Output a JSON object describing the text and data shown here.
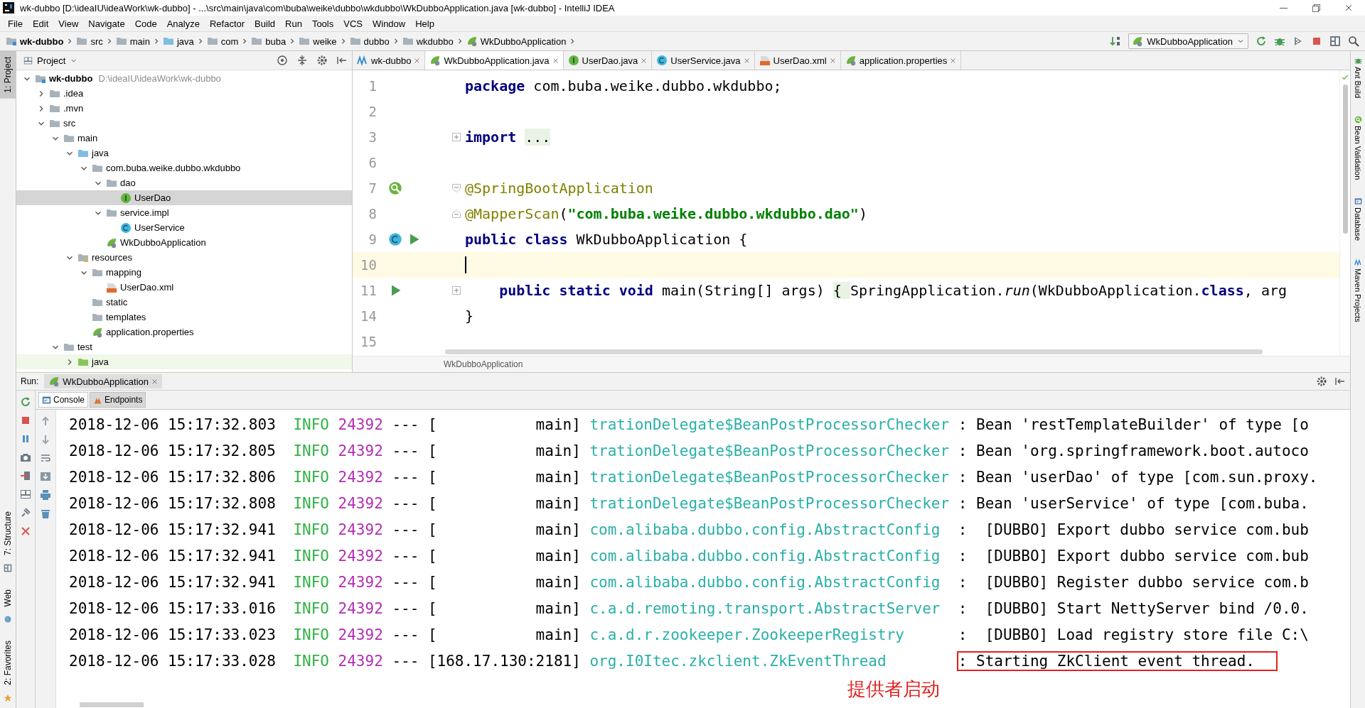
{
  "window": {
    "title": "wk-dubbo [D:\\ideaIU\\ideaWork\\wk-dubbo] - ...\\src\\main\\java\\com\\buba\\weike\\dubbo\\wkdubbo\\WkDubboApplication.java [wk-dubbo] - IntelliJ IDEA"
  },
  "menu": [
    "File",
    "Edit",
    "View",
    "Navigate",
    "Code",
    "Analyze",
    "Refactor",
    "Build",
    "Run",
    "Tools",
    "VCS",
    "Window",
    "Help"
  ],
  "breadcrumbs": [
    {
      "label": "wk-dubbo",
      "kind": "module"
    },
    {
      "label": "src",
      "kind": "folder"
    },
    {
      "label": "main",
      "kind": "folder"
    },
    {
      "label": "java",
      "kind": "source"
    },
    {
      "label": "com",
      "kind": "folder"
    },
    {
      "label": "buba",
      "kind": "folder"
    },
    {
      "label": "weike",
      "kind": "folder"
    },
    {
      "label": "dubbo",
      "kind": "folder"
    },
    {
      "label": "wkdubbo",
      "kind": "folder"
    },
    {
      "label": "WkDubboApplication",
      "kind": "spring"
    }
  ],
  "run_config": {
    "label": "WkDubboApplication"
  },
  "left_strip": [
    {
      "label": "1: Project",
      "selected": true
    },
    {
      "label": "7: Structure",
      "selected": false
    },
    {
      "label": "Web",
      "selected": false
    },
    {
      "label": "2: Favorites",
      "selected": false
    }
  ],
  "right_strip": [
    "Ant Build",
    "Bean Validation",
    "Database",
    "Maven Projects"
  ],
  "project": {
    "title": "Project",
    "tree": [
      {
        "label": "wk-dubbo",
        "kind": "module",
        "path": "D:\\ideaIU\\ideaWork\\wk-dubbo",
        "expanded": true,
        "selected": false,
        "children": [
          {
            "label": ".idea",
            "kind": "folder",
            "expanded": false,
            "selected": false
          },
          {
            "label": ".mvn",
            "kind": "folder",
            "expanded": false,
            "selected": false
          },
          {
            "label": "src",
            "kind": "folder",
            "expanded": true,
            "selected": false,
            "children": [
              {
                "label": "main",
                "kind": "folder",
                "expanded": true,
                "selected": false,
                "children": [
                  {
                    "label": "java",
                    "kind": "source",
                    "expanded": true,
                    "selected": false,
                    "children": [
                      {
                        "label": "com.buba.weike.dubbo.wkdubbo",
                        "kind": "folder",
                        "expanded": true,
                        "selected": false,
                        "children": [
                          {
                            "label": "dao",
                            "kind": "folder",
                            "expanded": true,
                            "selected": false,
                            "children": [
                              {
                                "label": "UserDao",
                                "kind": "interface",
                                "selected": true
                              }
                            ]
                          },
                          {
                            "label": "service.impl",
                            "kind": "folder",
                            "expanded": true,
                            "selected": false,
                            "children": [
                              {
                                "label": "UserService",
                                "kind": "class",
                                "selected": false
                              }
                            ]
                          },
                          {
                            "label": "WkDubboApplication",
                            "kind": "spring",
                            "selected": false
                          }
                        ]
                      }
                    ]
                  },
                  {
                    "label": "resources",
                    "kind": "resources",
                    "expanded": true,
                    "selected": false,
                    "children": [
                      {
                        "label": "mapping",
                        "kind": "folder",
                        "expanded": true,
                        "selected": false,
                        "children": [
                          {
                            "label": "UserDao.xml",
                            "kind": "xml",
                            "selected": false
                          }
                        ]
                      },
                      {
                        "label": "static",
                        "kind": "folder",
                        "selected": false
                      },
                      {
                        "label": "templates",
                        "kind": "folder",
                        "selected": false
                      },
                      {
                        "label": "application.properties",
                        "kind": "properties",
                        "selected": false
                      }
                    ]
                  }
                ]
              },
              {
                "label": "test",
                "kind": "folder",
                "expanded": true,
                "selected": false,
                "children": [
                  {
                    "label": "java",
                    "kind": "test",
                    "expanded": false,
                    "selected": false
                  }
                ]
              }
            ]
          }
        ]
      }
    ]
  },
  "editor": {
    "tabs": [
      {
        "label": "wk-dubbo",
        "kind": "maven",
        "selected": false
      },
      {
        "label": "WkDubboApplication.java",
        "kind": "spring",
        "selected": true
      },
      {
        "label": "UserDao.java",
        "kind": "interface",
        "selected": false
      },
      {
        "label": "UserService.java",
        "kind": "class",
        "selected": false
      },
      {
        "label": "UserDao.xml",
        "kind": "xml",
        "selected": false
      },
      {
        "label": "application.properties",
        "kind": "properties",
        "selected": false
      }
    ],
    "lines": [
      {
        "number": "1",
        "current": false,
        "code": [
          {
            "kind": "keyword",
            "text": "package"
          },
          {
            "kind": "plain",
            "text": " com.buba.weike.dubbo.wkdubbo;"
          }
        ]
      },
      {
        "number": "2",
        "current": false
      },
      {
        "number": "3",
        "current": false,
        "code": [
          {
            "kind": "keyword",
            "text": "import"
          },
          {
            "kind": "folded",
            "text": "..."
          }
        ]
      },
      {
        "number": "6",
        "current": false
      },
      {
        "number": "7",
        "current": false,
        "code": [
          {
            "kind": "annotation",
            "text": "@SpringBootApplication"
          }
        ]
      },
      {
        "number": "8",
        "current": false,
        "code": [
          {
            "kind": "annotation",
            "text": "@MapperScan"
          },
          {
            "kind": "plain",
            "text": "("
          },
          {
            "kind": "string",
            "text": "\"com.buba.weike.dubbo.wkdubbo.dao\""
          },
          {
            "kind": "plain",
            "text": ")"
          }
        ]
      },
      {
        "number": "9",
        "current": false,
        "code": [
          {
            "kind": "keyword",
            "text": "public class"
          },
          {
            "kind": "plain",
            "text": " WkDubboApplication {"
          }
        ]
      },
      {
        "number": "10",
        "current": true
      },
      {
        "number": "11",
        "current": false,
        "indented": true,
        "code": [
          {
            "kind": "keyword",
            "text": "public static void"
          },
          {
            "kind": "plain",
            "text": " main(String[] args) "
          },
          {
            "kind": "folded",
            "text": "{ "
          },
          {
            "kind": "plain",
            "text": "SpringApplication."
          },
          {
            "kind": "italic",
            "text": "run"
          },
          {
            "kind": "plain",
            "text": "(WkDubboApplication."
          },
          {
            "kind": "keyword",
            "text": "class"
          },
          {
            "kind": "plain",
            "text": ", arg"
          }
        ]
      },
      {
        "number": "14",
        "current": false,
        "code": [
          {
            "kind": "plain",
            "text": "}"
          }
        ]
      },
      {
        "number": "15",
        "current": false
      }
    ],
    "breadcrumb": "WkDubboApplication"
  },
  "run": {
    "label": "Run:",
    "tab": "WkDubboApplication",
    "tabs": [
      {
        "label": "Console",
        "kind": "console",
        "selected": true
      },
      {
        "label": "Endpoints",
        "kind": "endpoints",
        "selected": false
      }
    ],
    "log": [
      {
        "timestamp": "2018-12-06 15:17:32.803",
        "level": "INFO",
        "pid": "24392",
        "sep": "---",
        "thread": "[           main]",
        "logger": "trationDelegate$BeanPostProcessorChecker",
        "message": ": Bean 'restTemplateBuilder' of type [o",
        "highlighted": false
      },
      {
        "timestamp": "2018-12-06 15:17:32.805",
        "level": "INFO",
        "pid": "24392",
        "sep": "---",
        "thread": "[           main]",
        "logger": "trationDelegate$BeanPostProcessorChecker",
        "message": ": Bean 'org.springframework.boot.autoco",
        "highlighted": false
      },
      {
        "timestamp": "2018-12-06 15:17:32.806",
        "level": "INFO",
        "pid": "24392",
        "sep": "---",
        "thread": "[           main]",
        "logger": "trationDelegate$BeanPostProcessorChecker",
        "message": ": Bean 'userDao' of type [com.sun.proxy.",
        "highlighted": false
      },
      {
        "timestamp": "2018-12-06 15:17:32.808",
        "level": "INFO",
        "pid": "24392",
        "sep": "---",
        "thread": "[           main]",
        "logger": "trationDelegate$BeanPostProcessorChecker",
        "message": ": Bean 'userService' of type [com.buba.",
        "highlighted": false
      },
      {
        "timestamp": "2018-12-06 15:17:32.941",
        "level": "INFO",
        "pid": "24392",
        "sep": "---",
        "thread": "[           main]",
        "logger": "com.alibaba.dubbo.config.AbstractConfig",
        "message": ":  [DUBBO] Export dubbo service com.bub",
        "highlighted": false
      },
      {
        "timestamp": "2018-12-06 15:17:32.941",
        "level": "INFO",
        "pid": "24392",
        "sep": "---",
        "thread": "[           main]",
        "logger": "com.alibaba.dubbo.config.AbstractConfig",
        "message": ":  [DUBBO] Export dubbo service com.bub",
        "highlighted": false
      },
      {
        "timestamp": "2018-12-06 15:17:32.941",
        "level": "INFO",
        "pid": "24392",
        "sep": "---",
        "thread": "[           main]",
        "logger": "com.alibaba.dubbo.config.AbstractConfig",
        "message": ":  [DUBBO] Register dubbo service com.b",
        "highlighted": false
      },
      {
        "timestamp": "2018-12-06 15:17:33.016",
        "level": "INFO",
        "pid": "24392",
        "sep": "---",
        "thread": "[           main]",
        "logger": "c.a.d.remoting.transport.AbstractServer",
        "message": ":  [DUBBO] Start NettyServer bind /0.0.",
        "highlighted": false
      },
      {
        "timestamp": "2018-12-06 15:17:33.023",
        "level": "INFO",
        "pid": "24392",
        "sep": "---",
        "thread": "[           main]",
        "logger": "c.a.d.r.zookeeper.ZookeeperRegistry",
        "message": ":  [DUBBO] Load registry store file C:\\",
        "highlighted": false
      },
      {
        "timestamp": "2018-12-06 15:17:33.028",
        "level": "INFO",
        "pid": "24392",
        "sep": "---",
        "thread": "[168.17.130:2181]",
        "logger": "org.I0Itec.zkclient.ZkEventThread",
        "message": ": Starting ZkClient event thread.",
        "highlighted": true
      }
    ],
    "annotation": "提供者启动"
  }
}
